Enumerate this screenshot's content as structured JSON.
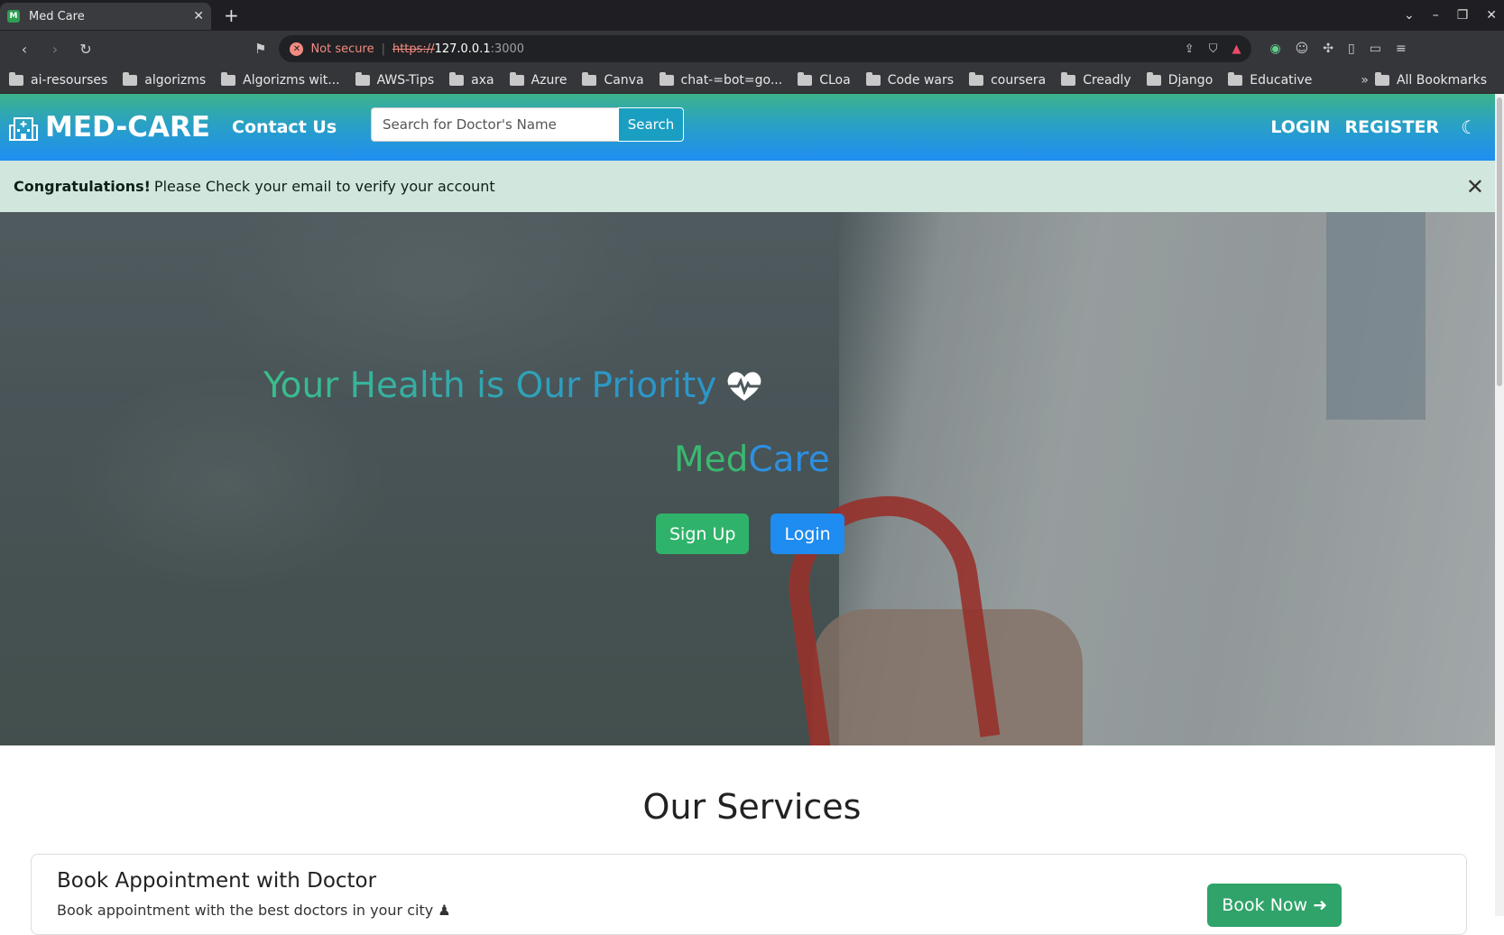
{
  "browser": {
    "tab_title": "Med Care",
    "tab_favicon": "M",
    "new_tab": "+",
    "security_label": "Not secure",
    "url_scheme": "https://",
    "url_host": "127.0.0.1",
    "url_port": ":3000",
    "bookmarks": [
      "ai-resourses",
      "algorizms",
      "Algorizms wit...",
      "AWS-Tips",
      "axa",
      "Azure",
      "Canva",
      "chat-=bot=go...",
      "CLoa",
      "Code wars",
      "coursera",
      "Creadly",
      "Django",
      "Educative"
    ],
    "bookmarks_more": "»",
    "all_bookmarks": "All Bookmarks"
  },
  "nav": {
    "brand": "MED-CARE",
    "contact": "Contact Us",
    "search_placeholder": "Search for Doctor's Name",
    "search_button": "Search",
    "login": "LOGIN",
    "register": "REGISTER"
  },
  "alert": {
    "strong": "Congratulations!",
    "message": "Please Check your email to verify your account"
  },
  "hero": {
    "title": "Your Health is Our Priority",
    "brand_med": "Med",
    "brand_care": "Care",
    "signup": "Sign Up",
    "login": "Login"
  },
  "services": {
    "title": "Our Services",
    "card_title": "Book Appointment with Doctor",
    "card_text": "Book appointment with the best doctors in your city",
    "card_button": "Book Now"
  },
  "colors": {
    "nav_gradient_start": "#3cb38a",
    "nav_gradient_end": "#1f8ef1",
    "alert_bg": "#d1e7dd",
    "green_button": "#2fb36a",
    "blue_button": "#1e8cf0"
  },
  "icons": [
    "hospital-icon",
    "moon-icon",
    "close-icon",
    "heart-pulse-icon",
    "arrow-right-icon",
    "person-icon"
  ]
}
